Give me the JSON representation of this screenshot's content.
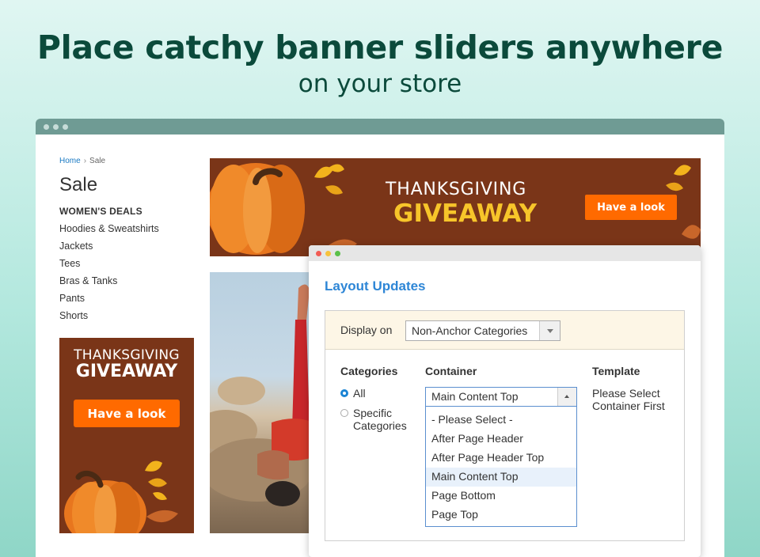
{
  "hero": {
    "title": "Place catchy banner sliders anywhere",
    "subtitle": "on your store"
  },
  "store": {
    "breadcrumb": {
      "home": "Home",
      "current": "Sale"
    },
    "page_title": "Sale",
    "category_heading": "WOMEN'S DEALS",
    "categories": [
      "Hoodies & Sweatshirts",
      "Jackets",
      "Tees",
      "Bras & Tanks",
      "Pants",
      "Shorts"
    ]
  },
  "banners": {
    "line1": "THANKSGIVING",
    "line2": "GIVEAWAY",
    "cta": "Have a look"
  },
  "panel": {
    "title": "Layout Updates",
    "display_label": "Display on",
    "display_value": "Non-Anchor Categories",
    "categories_header": "Categories",
    "container_header": "Container",
    "template_header": "Template",
    "radio_all": "All",
    "radio_specific_line1": "Specific",
    "radio_specific_line2": "Categories",
    "container_value": "Main Content Top",
    "container_options": [
      "- Please Select -",
      "After Page Header",
      "After Page Header Top",
      "Main Content Top",
      "Page Bottom",
      "Page Top"
    ],
    "template_text": "Please Select Container First"
  },
  "colors": {
    "hero_text": "#0b4a3b",
    "banner_bg": "#7a3518",
    "cta_orange": "#ff6a00",
    "giveaway_yellow": "#f7c52a",
    "link_blue": "#2e86d6"
  }
}
